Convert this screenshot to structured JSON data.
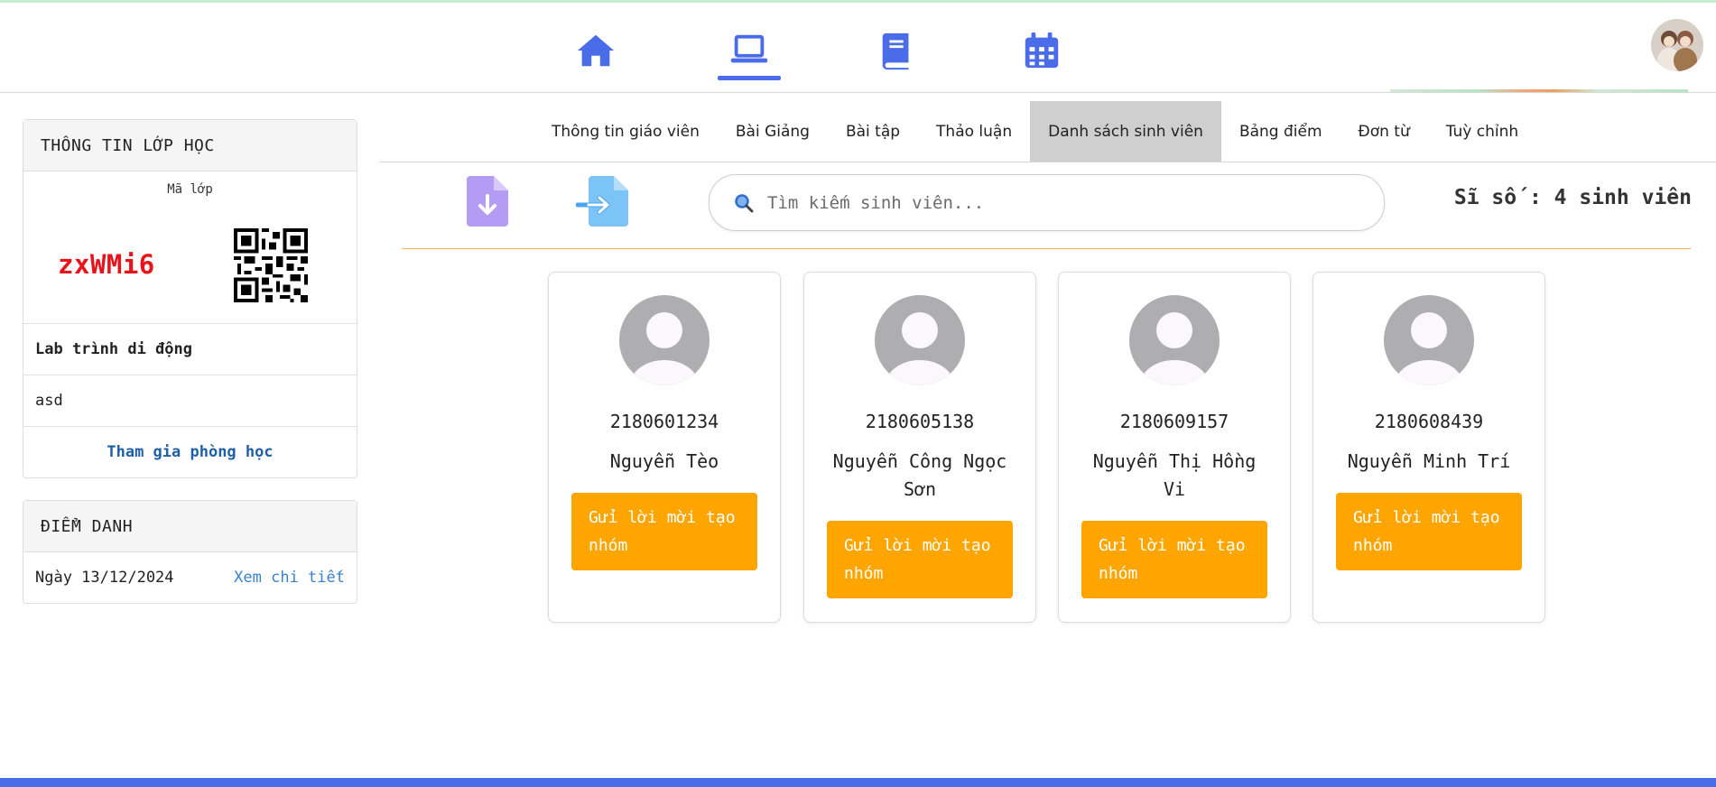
{
  "header": {
    "nav": [
      {
        "icon": "home-icon"
      },
      {
        "icon": "laptop-icon",
        "active": true
      },
      {
        "icon": "book-icon"
      },
      {
        "icon": "calendar-icon"
      }
    ],
    "accent_color": "#4a6ce8"
  },
  "class_info": {
    "title": "THÔNG TIN LỚP HỌC",
    "code_label": "Mã lớp",
    "code": "zxWMi6",
    "class_name": "Lab trình di động",
    "description": "asd",
    "join_link": "Tham gia phòng học"
  },
  "attendance": {
    "title": "ĐIỂM DANH",
    "date": "Ngày 13/12/2024",
    "detail_link": "Xem chi tiết"
  },
  "tabs": [
    {
      "label": "Thông tin giáo viên"
    },
    {
      "label": "Bài Giảng"
    },
    {
      "label": "Bài tập"
    },
    {
      "label": "Thảo luận"
    },
    {
      "label": "Danh sách sinh viên",
      "active": true
    },
    {
      "label": "Bảng điểm"
    },
    {
      "label": "Đơn từ"
    },
    {
      "label": "Tuỳ chỉnh"
    }
  ],
  "toolbar": {
    "search_placeholder": "Tìm kiếm sinh viên...",
    "count_text": "Sĩ số : 4 sinh viên"
  },
  "students": [
    {
      "id": "2180601234",
      "name": "Nguyễn Tèo",
      "button": "Gửi lời mời tạo nhóm"
    },
    {
      "id": "2180605138",
      "name": "Nguyễn Công Ngọc Sơn",
      "button": "Gửi lời mời tạo nhóm"
    },
    {
      "id": "2180609157",
      "name": "Nguyễn Thị Hồng Vi",
      "button": "Gửi lời mời tạo nhóm"
    },
    {
      "id": "2180608439",
      "name": "Nguyễn Minh Trí",
      "button": "Gửi lời mời tạo nhóm"
    }
  ],
  "colors": {
    "invite_button": "#ffa500",
    "class_code": "#e8141c",
    "active_tab": "#cfcfcf",
    "divider": "#f3b94a"
  }
}
